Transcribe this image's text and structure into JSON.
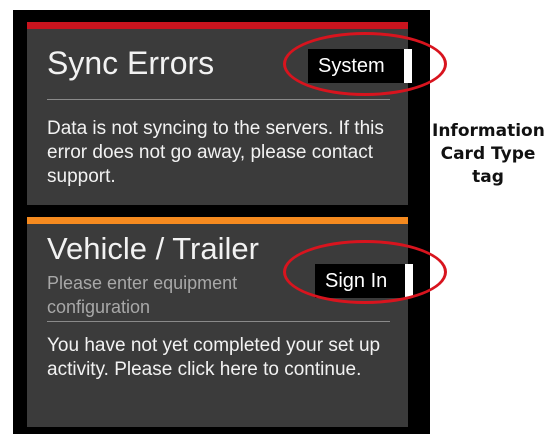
{
  "cards": [
    {
      "title": "Sync Errors",
      "tag": "System",
      "body": "Data is not syncing to the servers. If this error does not go away, please contact support.",
      "accent_color": "#c8141e"
    },
    {
      "title": "Vehicle / Trailer",
      "subtitle": "Please enter equipment configuration",
      "tag": "Sign In",
      "body": "You have not yet completed your set up activity. Please click here to continue.",
      "accent_color": "#f58a1f"
    }
  ],
  "annotation": {
    "text": "Information Card Type tag",
    "highlight_color": "#d8141e"
  }
}
